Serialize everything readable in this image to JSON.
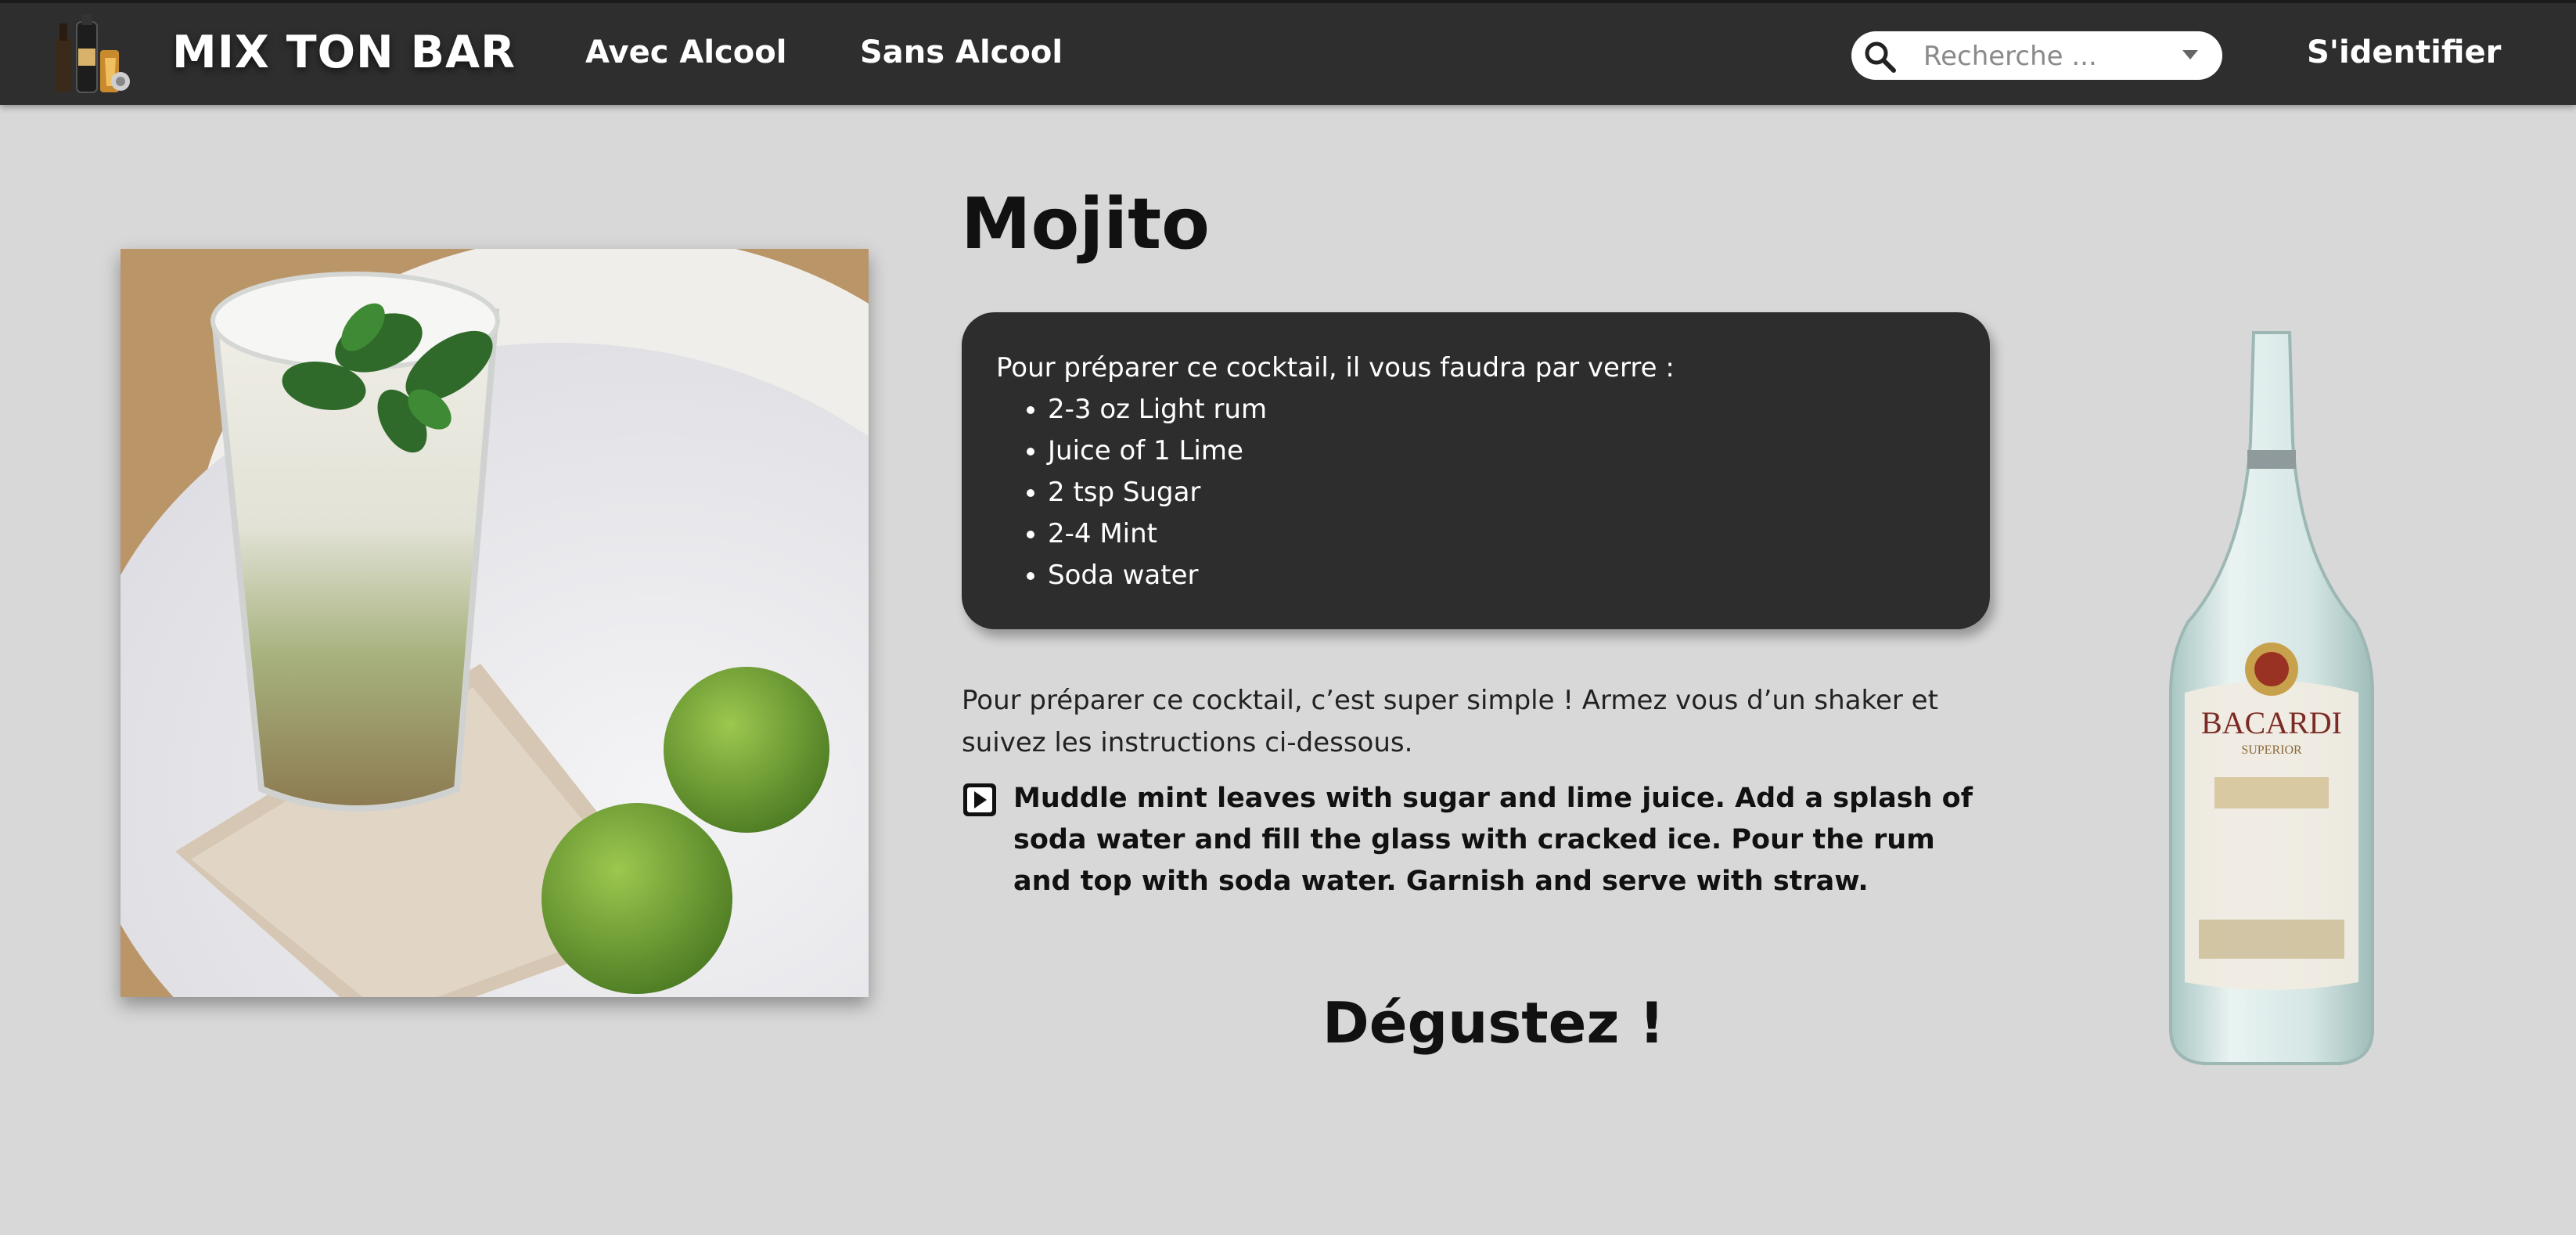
{
  "navbar": {
    "brand": "MIX TON BAR",
    "logo_icon": "bar-bottles-logo-icon",
    "links": [
      "Avec Alcool",
      "Sans Alcool"
    ],
    "search_placeholder": "Recherche ...",
    "search_icon": "search-icon",
    "dropdown_icon": "caret-down-icon",
    "login": "S'identifier",
    "background_color": "#2e2e2e"
  },
  "recipe": {
    "title": "Mojito",
    "ingredients_intro": "Pour préparer ce cocktail, il vous faudra par verre :",
    "ingredients": [
      "2-3 oz Light rum",
      "Juice of 1 Lime",
      "2 tsp Sugar",
      "2-4 Mint",
      "Soda water"
    ],
    "intro_text": "Pour préparer ce cocktail, c’est super simple ! Armez vous d’un shaker et suivez les instructions ci-dessous.",
    "instructions": "Muddle mint leaves with sugar and lime juice. Add a splash of soda water and fill the glass with cracked ice. Pour the rum and top with soda water. Garnish and serve with straw.",
    "instruction_icon": "play-icon",
    "outro": "Dégustez !",
    "photo": "mojito-glass-photo",
    "bottle": "bacardi-bottle-image",
    "bottle_label": "BACARDI",
    "bottle_sublabel": "SUPERIOR"
  }
}
